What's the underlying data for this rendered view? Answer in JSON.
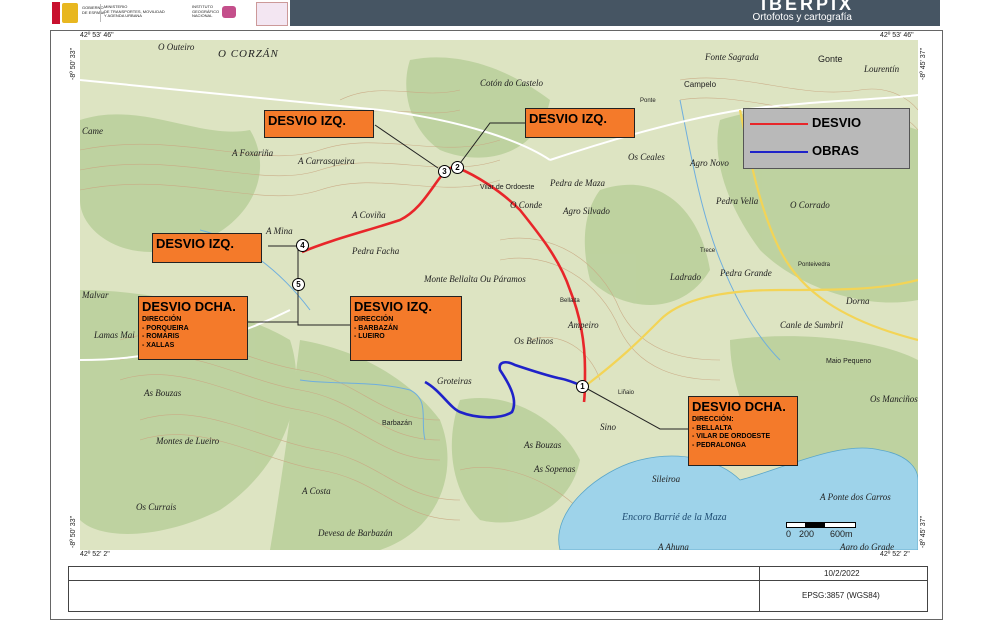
{
  "header": {
    "gov_lines": [
      "GOBIERNO",
      "DE ESPAÑA"
    ],
    "ministry_lines": [
      "MINISTERIO",
      "DE TRANSPORTES, MOVILIDAD",
      "Y AGENDA URBANA"
    ],
    "ign_lines": [
      "INSTITUTO",
      "GEOGRÁFICO",
      "NACIONAL"
    ],
    "brand": "IBERPIX",
    "brand_sub": "Ortofotos y cartografía"
  },
  "coords": {
    "top_left": "42º 53' 46\"",
    "top_right": "42º 53' 46\"",
    "bottom_left": "42º 52' 2\"",
    "bottom_right": "42º 52' 2\"",
    "left_top": "-8º 50' 33\"",
    "left_bottom": "-8º 50' 33\"",
    "right_top": "-8º 45' 37\"",
    "right_bottom": "-8º 45' 37\""
  },
  "legend": {
    "items": [
      {
        "label": "DESVIO",
        "color": "#e8262a"
      },
      {
        "label": "OBRAS",
        "color": "#1f22c9"
      }
    ]
  },
  "callouts": {
    "c1": {
      "head": "DESVIO IZQ."
    },
    "c2": {
      "head": "DESVIO IZQ."
    },
    "c3": {
      "head": "DESVIO IZQ."
    },
    "c4": {
      "head": "DESVIO DCHA.",
      "sub": [
        "DIRECCIÓN",
        "- PORQUEIRA",
        "- ROMARIS",
        "- XALLAS"
      ]
    },
    "c5": {
      "head": "DESVIO IZQ.",
      "sub": [
        "DIRECCIÓN",
        "- BARBAZÁN",
        "- LUEIRO"
      ]
    },
    "c6": {
      "head": "DESVIO DCHA.",
      "sub": [
        "DIRECCIÓN:",
        "-        BELLALTA",
        "-        VILAR DE ORDOESTE",
        "-        PEDRALONGA"
      ]
    }
  },
  "markers": [
    "1",
    "2",
    "3",
    "4",
    "5"
  ],
  "place_labels": [
    "O Outeiro",
    "O CORZÁN",
    "Cotón do Castelo",
    "Fonte Sagrada",
    "Gonte",
    "Lourentín",
    "Campelo",
    "Ponte",
    "Came",
    "A Foxariña",
    "A Carrasqueira",
    "Vilar de Ordoeste",
    "O Conde",
    "Pedra de Maza",
    "Os Ceales",
    "Agro Novo",
    "Agro Silvado",
    "Pedra Vella",
    "O Corrado",
    "A Coviña",
    "A Mina",
    "Pedra Facha",
    "Monte Bellalta Ou Páramos",
    "Ladrado",
    "Trece",
    "Pedra Grande",
    "Ponteivedra",
    "Malvar",
    "Bellalta",
    "Ampeiro",
    "Dorna",
    "Lamas Mai",
    "Os Belinos",
    "Canle de Sumbril",
    "Maio Pequeno",
    "As Bouzas",
    "Groteiras",
    "Liñaio",
    "Os Manciños",
    "Sino",
    "Barbazán",
    "Montes de Lueiro",
    "As Bouzas",
    "As Sopenas",
    "Sileiroa",
    "A Costa",
    "Os Currais",
    "Encoro Barrié de la Maza",
    "A Ponte dos Carros",
    "Devesa de Barbazán",
    "Agro do Grade",
    "A Ahuna"
  ],
  "scale": {
    "ticks": [
      "0",
      "200",
      "600m"
    ]
  },
  "table": {
    "date": "10/2/2022",
    "epsg": "EPSG:3857 (WGS84)"
  }
}
